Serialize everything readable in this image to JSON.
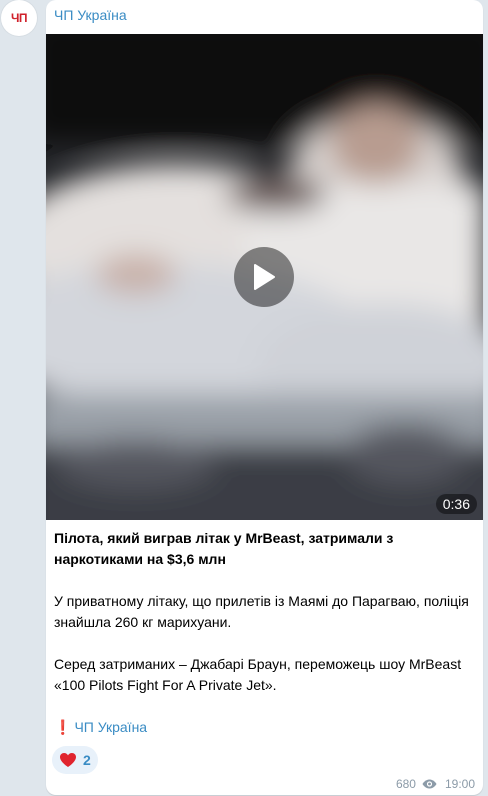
{
  "channel": {
    "avatar_text": "ЧП",
    "name": "ЧП Україна"
  },
  "video": {
    "duration": "0:36",
    "play_icon": "play-icon"
  },
  "post": {
    "title": "Пілота, який виграв літак у MrBeast, затримали з наркотиками на $3,6 млн",
    "paragraph1": "У приватному літаку, що прилетів із Маямі до Парагваю, поліція знайшла 260 кг марихуани.",
    "paragraph2": "Серед затриманих – Джабарі Браун, переможець шоу MrBeast «100 Pilots Fight For A Private Jet».",
    "signature_mark": "❗",
    "signature": "ЧП Україна"
  },
  "reaction": {
    "emoji": "heart-icon",
    "count": "2"
  },
  "meta": {
    "views": "680",
    "time": "19:00"
  },
  "colors": {
    "accent": "#3a8cc4",
    "background": "#dfe6ec",
    "reaction_bg": "#e8f1fa",
    "heart": "#e0242e"
  }
}
